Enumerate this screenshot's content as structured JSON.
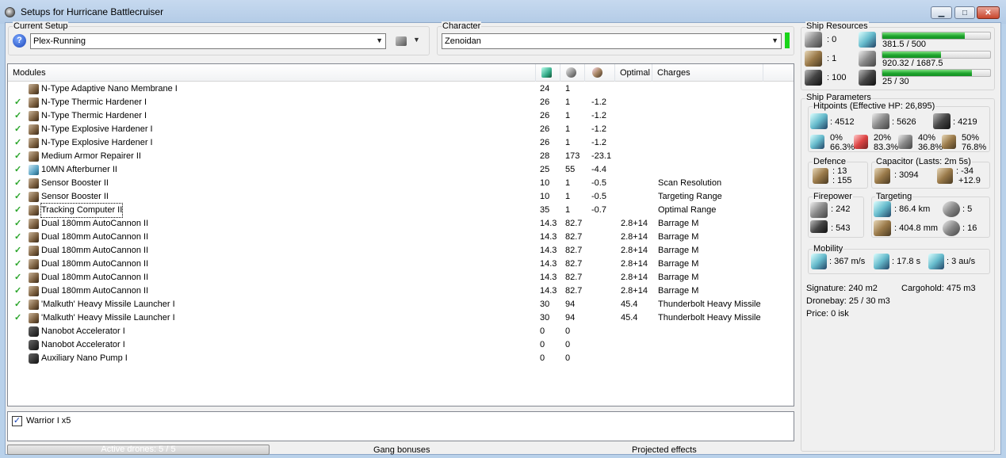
{
  "window": {
    "title": "Setups for Hurricane Battlecruiser"
  },
  "setup": {
    "label": "Current Setup",
    "value": "Plex-Running"
  },
  "character": {
    "label": "Character",
    "value": "Zenoidan"
  },
  "modules": {
    "headers": [
      "Modules",
      "Optimal",
      "Charges"
    ],
    "rows": [
      {
        "checked": false,
        "icon": "hardener-icon",
        "name": "N-Type Adaptive Nano Membrane I",
        "cpu": "24",
        "pg": "1",
        "cap": "",
        "optimal": "",
        "charges": ""
      },
      {
        "checked": true,
        "icon": "hardener-icon",
        "name": "N-Type Thermic Hardener I",
        "cpu": "26",
        "pg": "1",
        "cap": "-1.2",
        "optimal": "",
        "charges": ""
      },
      {
        "checked": true,
        "icon": "hardener-icon",
        "name": "N-Type Thermic Hardener I",
        "cpu": "26",
        "pg": "1",
        "cap": "-1.2",
        "optimal": "",
        "charges": ""
      },
      {
        "checked": true,
        "icon": "hardener-icon",
        "name": "N-Type Explosive Hardener I",
        "cpu": "26",
        "pg": "1",
        "cap": "-1.2",
        "optimal": "",
        "charges": ""
      },
      {
        "checked": true,
        "icon": "hardener-icon",
        "name": "N-Type Explosive Hardener I",
        "cpu": "26",
        "pg": "1",
        "cap": "-1.2",
        "optimal": "",
        "charges": ""
      },
      {
        "checked": true,
        "icon": "armor-repairer-icon",
        "name": "Medium Armor Repairer II",
        "cpu": "28",
        "pg": "173",
        "cap": "-23.1",
        "optimal": "",
        "charges": ""
      },
      {
        "checked": true,
        "icon": "afterburner-icon",
        "name": "10MN Afterburner II",
        "cpu": "25",
        "pg": "55",
        "cap": "-4.4",
        "optimal": "",
        "charges": ""
      },
      {
        "checked": true,
        "icon": "sensor-booster-icon",
        "name": "Sensor Booster II",
        "cpu": "10",
        "pg": "1",
        "cap": "-0.5",
        "optimal": "",
        "charges": "Scan Resolution"
      },
      {
        "checked": true,
        "icon": "sensor-booster-icon",
        "name": "Sensor Booster II",
        "cpu": "10",
        "pg": "1",
        "cap": "-0.5",
        "optimal": "",
        "charges": "Targeting Range"
      },
      {
        "checked": true,
        "icon": "tracking-computer-icon",
        "name": "Tracking Computer II",
        "cpu": "35",
        "pg": "1",
        "cap": "-0.7",
        "optimal": "",
        "charges": "Optimal Range"
      },
      {
        "checked": true,
        "icon": "autocannon-icon",
        "name": "Dual 180mm AutoCannon II",
        "cpu": "14.3",
        "pg": "82.7",
        "cap": "",
        "optimal": "2.8+14",
        "charges": "Barrage M"
      },
      {
        "checked": true,
        "icon": "autocannon-icon",
        "name": "Dual 180mm AutoCannon II",
        "cpu": "14.3",
        "pg": "82.7",
        "cap": "",
        "optimal": "2.8+14",
        "charges": "Barrage M"
      },
      {
        "checked": true,
        "icon": "autocannon-icon",
        "name": "Dual 180mm AutoCannon II",
        "cpu": "14.3",
        "pg": "82.7",
        "cap": "",
        "optimal": "2.8+14",
        "charges": "Barrage M"
      },
      {
        "checked": true,
        "icon": "autocannon-icon",
        "name": "Dual 180mm AutoCannon II",
        "cpu": "14.3",
        "pg": "82.7",
        "cap": "",
        "optimal": "2.8+14",
        "charges": "Barrage M"
      },
      {
        "checked": true,
        "icon": "autocannon-icon",
        "name": "Dual 180mm AutoCannon II",
        "cpu": "14.3",
        "pg": "82.7",
        "cap": "",
        "optimal": "2.8+14",
        "charges": "Barrage M"
      },
      {
        "checked": true,
        "icon": "autocannon-icon",
        "name": "Dual 180mm AutoCannon II",
        "cpu": "14.3",
        "pg": "82.7",
        "cap": "",
        "optimal": "2.8+14",
        "charges": "Barrage M"
      },
      {
        "checked": true,
        "icon": "missile-launcher-icon",
        "name": "'Malkuth' Heavy Missile Launcher I",
        "cpu": "30",
        "pg": "94",
        "cap": "",
        "optimal": "45.4",
        "charges": "Thunderbolt Heavy Missile"
      },
      {
        "checked": true,
        "icon": "missile-launcher-icon",
        "name": "'Malkuth' Heavy Missile Launcher I",
        "cpu": "30",
        "pg": "94",
        "cap": "",
        "optimal": "45.4",
        "charges": "Thunderbolt Heavy Missile"
      },
      {
        "checked": false,
        "icon": "rig-icon",
        "name": "Nanobot Accelerator I",
        "cpu": "0",
        "pg": "0",
        "cap": "",
        "optimal": "",
        "charges": ""
      },
      {
        "checked": false,
        "icon": "rig-icon",
        "name": "Nanobot Accelerator I",
        "cpu": "0",
        "pg": "0",
        "cap": "",
        "optimal": "",
        "charges": ""
      },
      {
        "checked": false,
        "icon": "rig-icon",
        "name": "Auxiliary Nano Pump I",
        "cpu": "0",
        "pg": "0",
        "cap": "",
        "optimal": "",
        "charges": ""
      }
    ]
  },
  "drones": {
    "item": "Warrior I x5",
    "progress_label": "Active drones: 5 / 5",
    "progress_fraction": 1.0
  },
  "bottom_tabs": {
    "gang": "Gang bonuses",
    "projected": "Projected effects"
  },
  "resources": {
    "label": "Ship Resources",
    "hardpoints": {
      "turret": ": 0",
      "launcher": ": 1",
      "calibration": ": 100"
    },
    "cpu": {
      "text": "381.5 / 500",
      "fraction": 0.763
    },
    "powergrid": {
      "text": "920.32 / 1687.5",
      "fraction": 0.545
    },
    "drone_bandwidth": {
      "text": "25 / 30",
      "fraction": 0.833
    }
  },
  "parameters": {
    "label": "Ship Parameters",
    "hitpoints_label": "Hitpoints (Effective HP: 26,895)",
    "shield": ": 4512",
    "armor": ": 5626",
    "structure": ": 4219",
    "resists": [
      {
        "top": "0%",
        "bottom": "66.3%"
      },
      {
        "top": "20%",
        "bottom": "83.3%"
      },
      {
        "top": "40%",
        "bottom": "36.8%"
      },
      {
        "top": "50%",
        "bottom": "76.8%"
      }
    ],
    "defence": {
      "label": "Defence",
      "a": ": 13",
      "b": ": 155"
    },
    "capacitor": {
      "label": "Capacitor (Lasts: 2m 5s)",
      "amount": ": 3094",
      "delta_a": ": -34",
      "delta_b": "+12.9"
    },
    "firepower": {
      "label": "Firepower",
      "a": ": 242",
      "b": ": 543"
    },
    "targeting": {
      "label": "Targeting",
      "range": ": 86.4 km",
      "targets": ": 5",
      "resolution": ": 404.8 mm",
      "strength": ": 16"
    },
    "mobility": {
      "label": "Mobility",
      "speed": ": 367 m/s",
      "align": ": 17.8 s",
      "warp": ": 3 au/s"
    },
    "signature": "Signature: 240 m2",
    "cargohold": "Cargohold: 475 m3",
    "dronebay": "Dronebay: 25 / 30 m3",
    "price": "Price: 0 isk"
  },
  "colors": {
    "accent_green": "#1fa52e",
    "checkmark": "#2aa52a",
    "titlebar": "#b9d1ea"
  }
}
